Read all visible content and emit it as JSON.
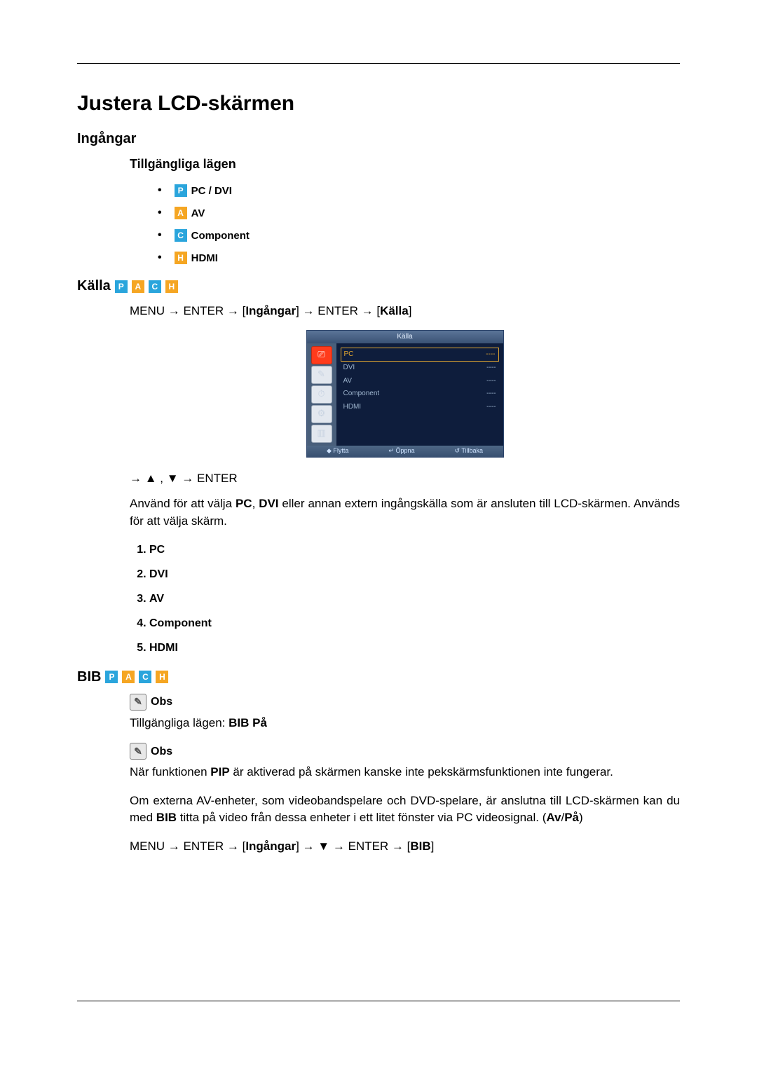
{
  "title": "Justera LCD-skärmen",
  "section_inputs": "Ingångar",
  "sub_modes": "Tillgängliga lägen",
  "badges": {
    "P": "P",
    "A": "A",
    "C": "C",
    "H": "H"
  },
  "modes": {
    "pc_dvi": "PC / DVI",
    "av": "AV",
    "component": "Component",
    "hdmi": "HDMI"
  },
  "kalla_heading": "Källa",
  "nav1": {
    "menu": "MENU",
    "enter1": "ENTER",
    "ing": "Ingångar",
    "enter2": "ENTER",
    "kalla": "Källa"
  },
  "osd": {
    "title": "Källa",
    "rows": [
      "PC",
      "DVI",
      "AV",
      "Component",
      "HDMI"
    ],
    "dash": "----",
    "footer": {
      "move": "Flytta",
      "open": "Öppna",
      "back": "Tillbaka"
    }
  },
  "arrow_line": "→ ▲ , ▼ → ENTER",
  "desc_p1a": "Använd för att välja ",
  "desc_pc": "PC",
  "desc_p1b": ", ",
  "desc_dvi": "DVI",
  "desc_p1c": " eller annan extern ingångskälla som är ansluten till LCD-skärmen. Används för att välja skärm.",
  "src_list": [
    "PC",
    "DVI",
    "AV",
    "Component",
    "HDMI"
  ],
  "bib_heading": "BIB",
  "obs_label": "Obs",
  "obs1_a": "Tillgängliga lägen: ",
  "obs1_b": "BIB På",
  "obs2": "När funktionen ",
  "obs2_pip": "PIP",
  "obs2_rest": " är aktiverad på skärmen kanske inte pekskärmsfunktionen inte fungerar.",
  "obs3_a": "Om externa AV-enheter, som videobandspelare och DVD-spelare, är anslutna till LCD-skärmen kan du med ",
  "obs3_bib": "BIB",
  "obs3_b": " titta på video från dessa enheter i ett litet fönster via PC videosignal. (",
  "obs3_av": "Av",
  "obs3_slash": "/",
  "obs3_pa": "På",
  "obs3_close": ")",
  "nav2": {
    "menu": "MENU",
    "enter1": "ENTER",
    "ing": "Ingångar",
    "enter2": "ENTER",
    "bib": "BIB"
  }
}
